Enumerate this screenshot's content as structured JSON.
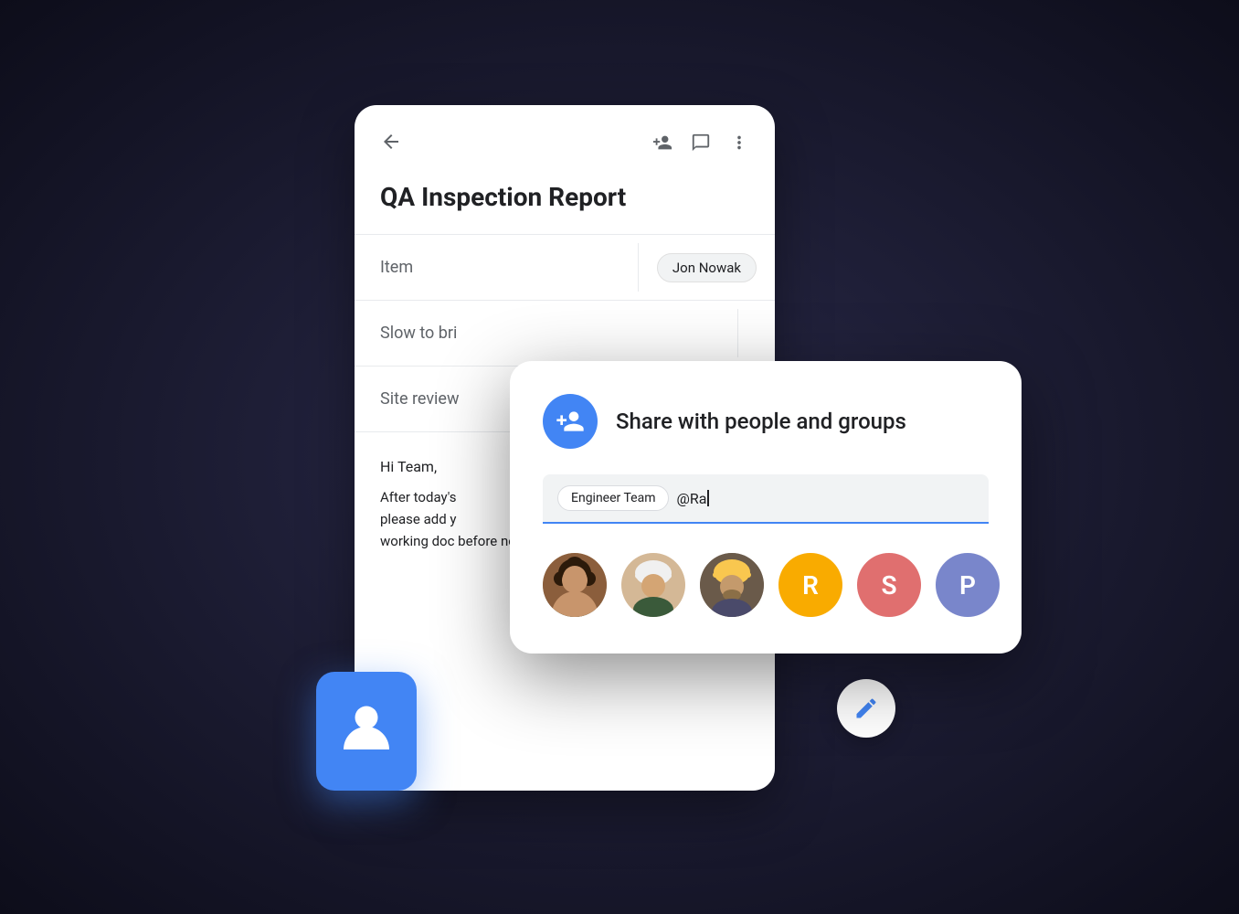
{
  "scene": {
    "background_color": "#1a1a2e"
  },
  "doc_card": {
    "back_icon": "←",
    "title": "QA Inspection Report",
    "table": {
      "rows": [
        {
          "left": "Item",
          "right": "Jon Nowak",
          "has_badge": true
        },
        {
          "left": "Slow to bri",
          "right": "",
          "has_badge": false
        },
        {
          "left": "Site review",
          "right": "",
          "has_badge": false
        }
      ]
    },
    "body": {
      "greeting": "Hi Team,",
      "text": "After today's please add y working doc before next week."
    }
  },
  "fab": {
    "icon": "✏️"
  },
  "share_dialog": {
    "icon_label": "person-add",
    "title": "Share with people and groups",
    "chip_label": "Engineer Team",
    "input_text": "@Ra",
    "avatars": [
      {
        "type": "photo",
        "style": 1,
        "label": "Person 1"
      },
      {
        "type": "photo",
        "style": 2,
        "label": "Person 2"
      },
      {
        "type": "photo",
        "style": 3,
        "label": "Person 3"
      },
      {
        "type": "letter",
        "letter": "R",
        "color": "avatar-r",
        "label": "R"
      },
      {
        "type": "letter",
        "letter": "S",
        "color": "avatar-s",
        "label": "S"
      },
      {
        "type": "letter",
        "letter": "P",
        "color": "avatar-p",
        "label": "P"
      }
    ]
  },
  "person_card": {
    "icon": "👤"
  }
}
